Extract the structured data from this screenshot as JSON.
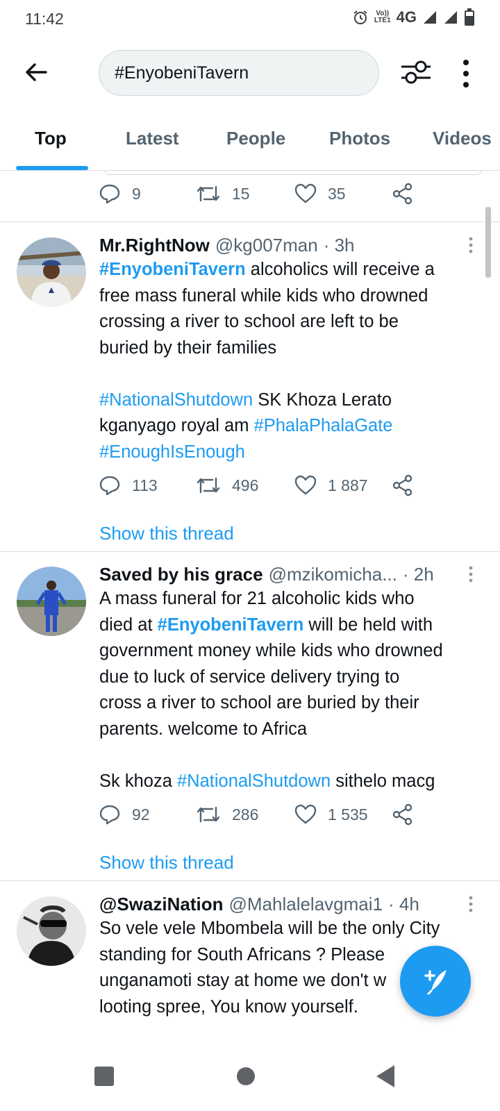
{
  "status_bar": {
    "time": "11:42",
    "volte_line1": "Vo))",
    "volte_line2": "LTE1",
    "network": "4G"
  },
  "search": {
    "query": "#EnyobeniTavern"
  },
  "tabs": [
    {
      "label": "Top",
      "active": true
    },
    {
      "label": "Latest"
    },
    {
      "label": "People"
    },
    {
      "label": "Photos"
    },
    {
      "label": "Videos"
    }
  ],
  "previous_tweet_actions": {
    "replies": "9",
    "retweets": "15",
    "likes": "35"
  },
  "tweets": [
    {
      "name": "Mr.RightNow",
      "handle": "@kg007man",
      "time": "· 3h",
      "lines": [
        [
          "#EnyobeniTavern",
          "  alcoholics will receive a"
        ],
        "free mass funeral while kids who drowned",
        "crossing a river to school are left to be",
        "buried by their families",
        [
          "#NationalShutdown",
          " SK Khoza Lerato"
        ],
        [
          "kganyago royal am ",
          "#PhalaPhalaGate"
        ],
        "#EnoughIsEnough"
      ],
      "replies": "113",
      "retweets": "496",
      "likes": "1 887",
      "thread_link": "Show this thread"
    },
    {
      "name": "Saved by his grace",
      "handle": "@mzikomicha...",
      "time": "· 2h",
      "lines": [
        "A mass funeral for 21 alcoholic kids who",
        [
          "died at ",
          "#EnyobeniTavern",
          " will be held with"
        ],
        "government money while kids who drowned",
        "due to luck of service delivery trying to",
        "cross a river to school are buried by their",
        "parents. welcome to Africa",
        [
          "Sk khoza ",
          "#NationalShutdown",
          " sithelo macg"
        ]
      ],
      "replies": "92",
      "retweets": "286",
      "likes": "1 535",
      "thread_link": "Show this thread"
    },
    {
      "name": "@SwaziNation",
      "handle": "@Mahlalelavgmai1",
      "time": "· 4h",
      "lines": [
        "So vele vele Mbombela will be the only City",
        "standing for South Africans ? Please",
        "unganamoti stay at home we don't w",
        "looting spree, You know yourself."
      ]
    }
  ],
  "colors": {
    "accent": "#1d9bf0",
    "text": "#0f1419",
    "secondary": "#536471",
    "divider": "#d6dde2"
  },
  "icons": [
    "back-arrow-icon",
    "filter-icon",
    "more-vert-icon",
    "reply-icon",
    "retweet-icon",
    "like-icon",
    "share-icon",
    "compose-tweet-icon",
    "nav-recents-icon",
    "nav-home-icon",
    "nav-back-icon"
  ]
}
